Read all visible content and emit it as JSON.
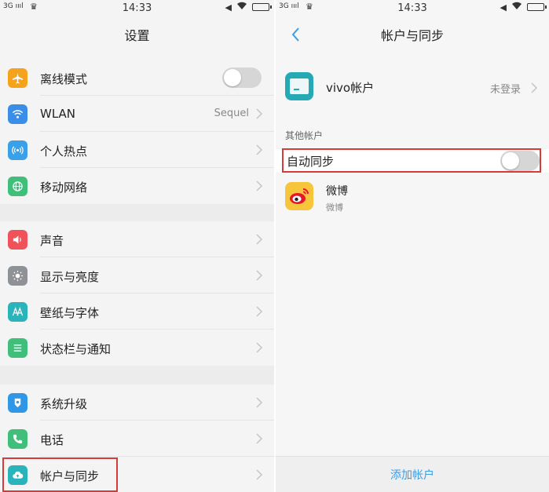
{
  "status_bar": {
    "signal": "3G",
    "time": "14:33"
  },
  "left": {
    "title": "设置",
    "groups": [
      [
        {
          "label": "离线模式",
          "icon": "airplane-icon",
          "color": "#f5a21c",
          "toggle": false
        },
        {
          "label": "WLAN",
          "icon": "wifi-icon",
          "color": "#3a8ee8",
          "value": "Sequel"
        },
        {
          "label": "个人热点",
          "icon": "hotspot-icon",
          "color": "#3aa0e8"
        },
        {
          "label": "移动网络",
          "icon": "globe-icon",
          "color": "#3fbf7a"
        }
      ],
      [
        {
          "label": "声音",
          "icon": "speaker-icon",
          "color": "#f0525a"
        },
        {
          "label": "显示与亮度",
          "icon": "brightness-icon",
          "color": "#8e9196"
        },
        {
          "label": "壁纸与字体",
          "icon": "font-icon",
          "color": "#29b3ba"
        },
        {
          "label": "状态栏与通知",
          "icon": "list-icon",
          "color": "#3fbf7a"
        }
      ],
      [
        {
          "label": "系统升级",
          "icon": "upgrade-icon",
          "color": "#2f97e6"
        },
        {
          "label": "电话",
          "icon": "phone-icon",
          "color": "#3fbf7a"
        },
        {
          "label": "帐户与同步",
          "icon": "cloud-sync-icon",
          "color": "#29b3ba"
        }
      ]
    ]
  },
  "right": {
    "title": "帐户与同步",
    "vivo_account": {
      "label": "vivo帐户",
      "status": "未登录"
    },
    "section_title": "其他帐户",
    "auto_sync": {
      "label": "自动同步",
      "on": false
    },
    "weibo": {
      "name": "微博",
      "sub": "微博"
    },
    "add_account": "添加帐户"
  },
  "colors": {
    "highlight": "#d83a3a",
    "accent": "#3a9ee6"
  }
}
